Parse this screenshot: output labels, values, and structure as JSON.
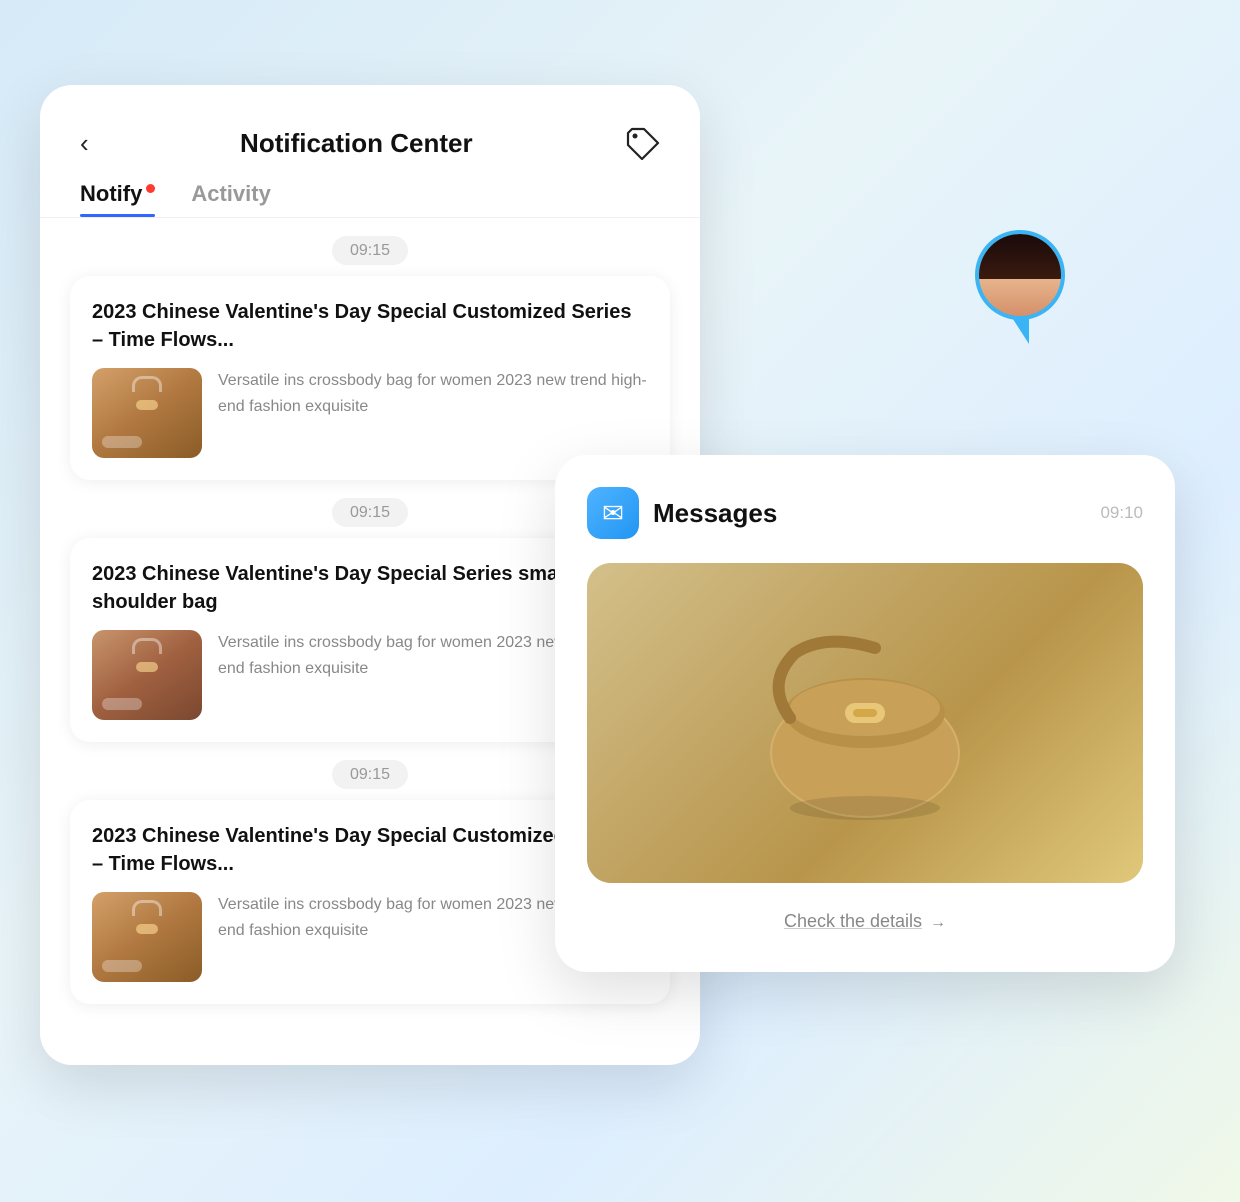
{
  "page": {
    "background": "light-blue-gradient"
  },
  "notification_card": {
    "back_label": "‹",
    "title": "Notification Center",
    "tabs": [
      {
        "id": "notify",
        "label": "Notify",
        "active": true,
        "has_dot": true
      },
      {
        "id": "activity",
        "label": "Activity",
        "active": false,
        "has_dot": false
      }
    ],
    "notifications": [
      {
        "time": "09:15",
        "title": "2023 Chinese Valentine's Day Special Customized Series – Time Flows...",
        "description": "Versatile ins crossbody bag for women 2023 new trend high-end fashion exquisite"
      },
      {
        "time": "09:15",
        "title": "2023 Chinese Valentine's Day Special Series small shoulder bag",
        "description": "Versatile ins crossbody bag for women 2023 new trend high-end fashion exquisite"
      },
      {
        "time": "09:15",
        "title": "2023 Chinese Valentine's Day Special Customized Series – Time Flows...",
        "description": "Versatile ins crossbody bag for women 2023 new trend high-end fashion exquisite"
      }
    ]
  },
  "messages_card": {
    "icon": "envelope",
    "title": "Messages",
    "time": "09:10",
    "check_details_label": "Check the details",
    "arrow": "→"
  }
}
